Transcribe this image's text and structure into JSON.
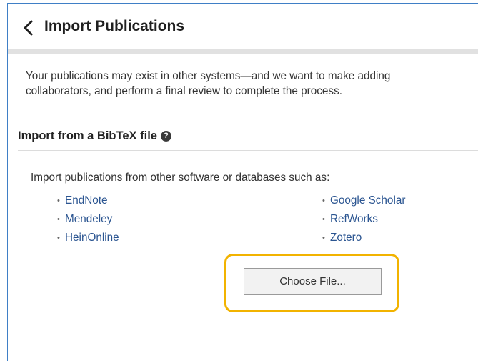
{
  "header": {
    "title": "Import Publications"
  },
  "intro": {
    "line1": "Your publications may exist in other systems—and we want to make adding",
    "line2": "collaborators, and perform a final review to complete the process."
  },
  "bibtex": {
    "heading": "Import from a BibTeX file",
    "lead": "Import publications from other software or databases such as:",
    "sources_left": [
      "EndNote",
      "Mendeley",
      "HeinOnline"
    ],
    "sources_right": [
      "Google Scholar",
      "RefWorks",
      "Zotero"
    ],
    "choose_file_label": "Choose File..."
  },
  "colors": {
    "link": "#2b5591",
    "highlight": "#f2b300",
    "frame": "#3f7fc6"
  }
}
